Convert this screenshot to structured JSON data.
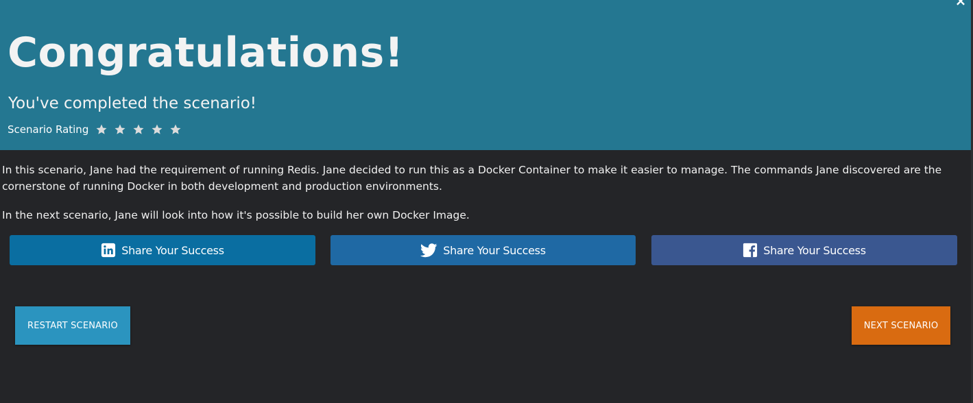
{
  "header": {
    "close_symbol": "×",
    "title": "Congratulations!",
    "subtitle": "You've completed the scenario!",
    "rating_label": "Scenario Rating",
    "rating_stars": 5,
    "star_icon": "star-icon"
  },
  "content": {
    "paragraph_1": "In this scenario, Jane had the requirement of running Redis. Jane decided to run this as a Docker Container to make it easier to manage. The commands Jane discovered are the cornerstone of running Docker in both development and production environments.",
    "paragraph_2": "In the next scenario, Jane will look into how it's possible to build her own Docker Image."
  },
  "share": {
    "linkedin": {
      "label": "Share Your Success",
      "icon": "linkedin-icon",
      "color": "#0a6ea1"
    },
    "twitter": {
      "label": "Share Your Success",
      "icon": "twitter-icon",
      "color": "#1f69a4"
    },
    "facebook": {
      "label": "Share Your Success",
      "icon": "facebook-icon",
      "color": "#3a5790"
    }
  },
  "actions": {
    "restart_label": "RESTART SCENARIO",
    "next_label": "NEXT SCENARIO"
  },
  "colors": {
    "header_bg": "#247791",
    "body_bg": "#242528",
    "restart_bg": "#2b94bf",
    "next_bg": "#d96b11"
  }
}
